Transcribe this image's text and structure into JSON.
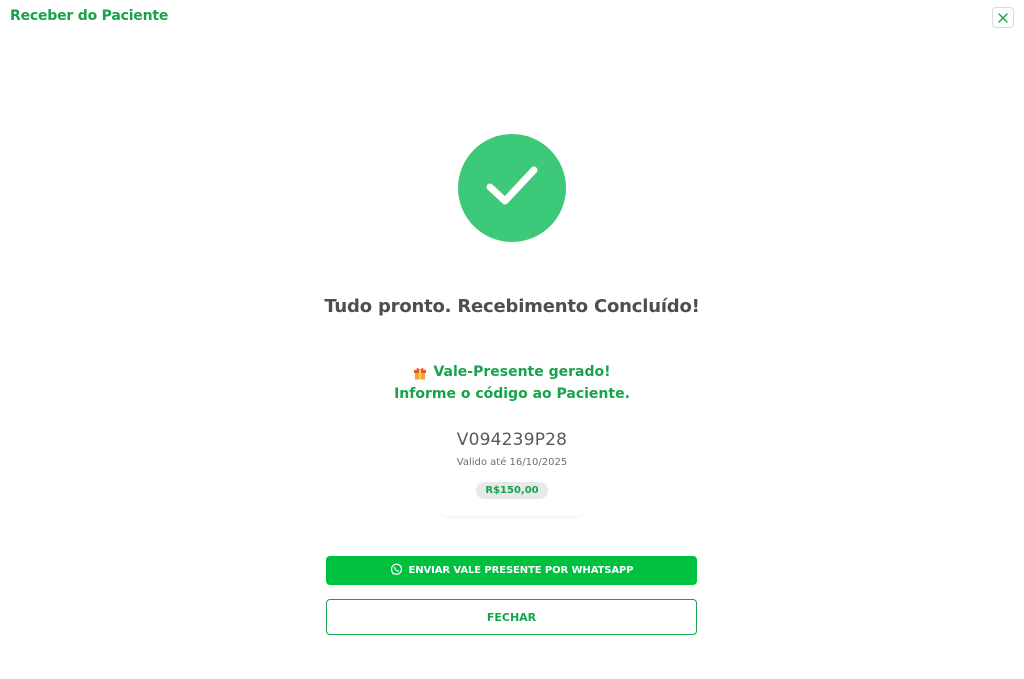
{
  "modal": {
    "title": "Receber do Paciente",
    "close_icon": "close-icon"
  },
  "success": {
    "icon": "check-icon",
    "color": "#3dc97a",
    "headline": "Tudo pronto. Recebimento Concluído!"
  },
  "gift": {
    "icon": "gift-icon",
    "line1": "Vale-Presente gerado!",
    "line2": "Informe o código ao Paciente."
  },
  "voucher": {
    "code": "V094239P28",
    "valid_until": "Valido até 16/10/2025",
    "amount": "R$150,00"
  },
  "actions": {
    "whatsapp_icon": "whatsapp-icon",
    "whatsapp_label": "ENVIAR VALE PRESENTE POR WHATSAPP",
    "close_label": "FECHAR"
  },
  "colors": {
    "brand_green": "#16a34a",
    "button_green": "#00c040"
  }
}
